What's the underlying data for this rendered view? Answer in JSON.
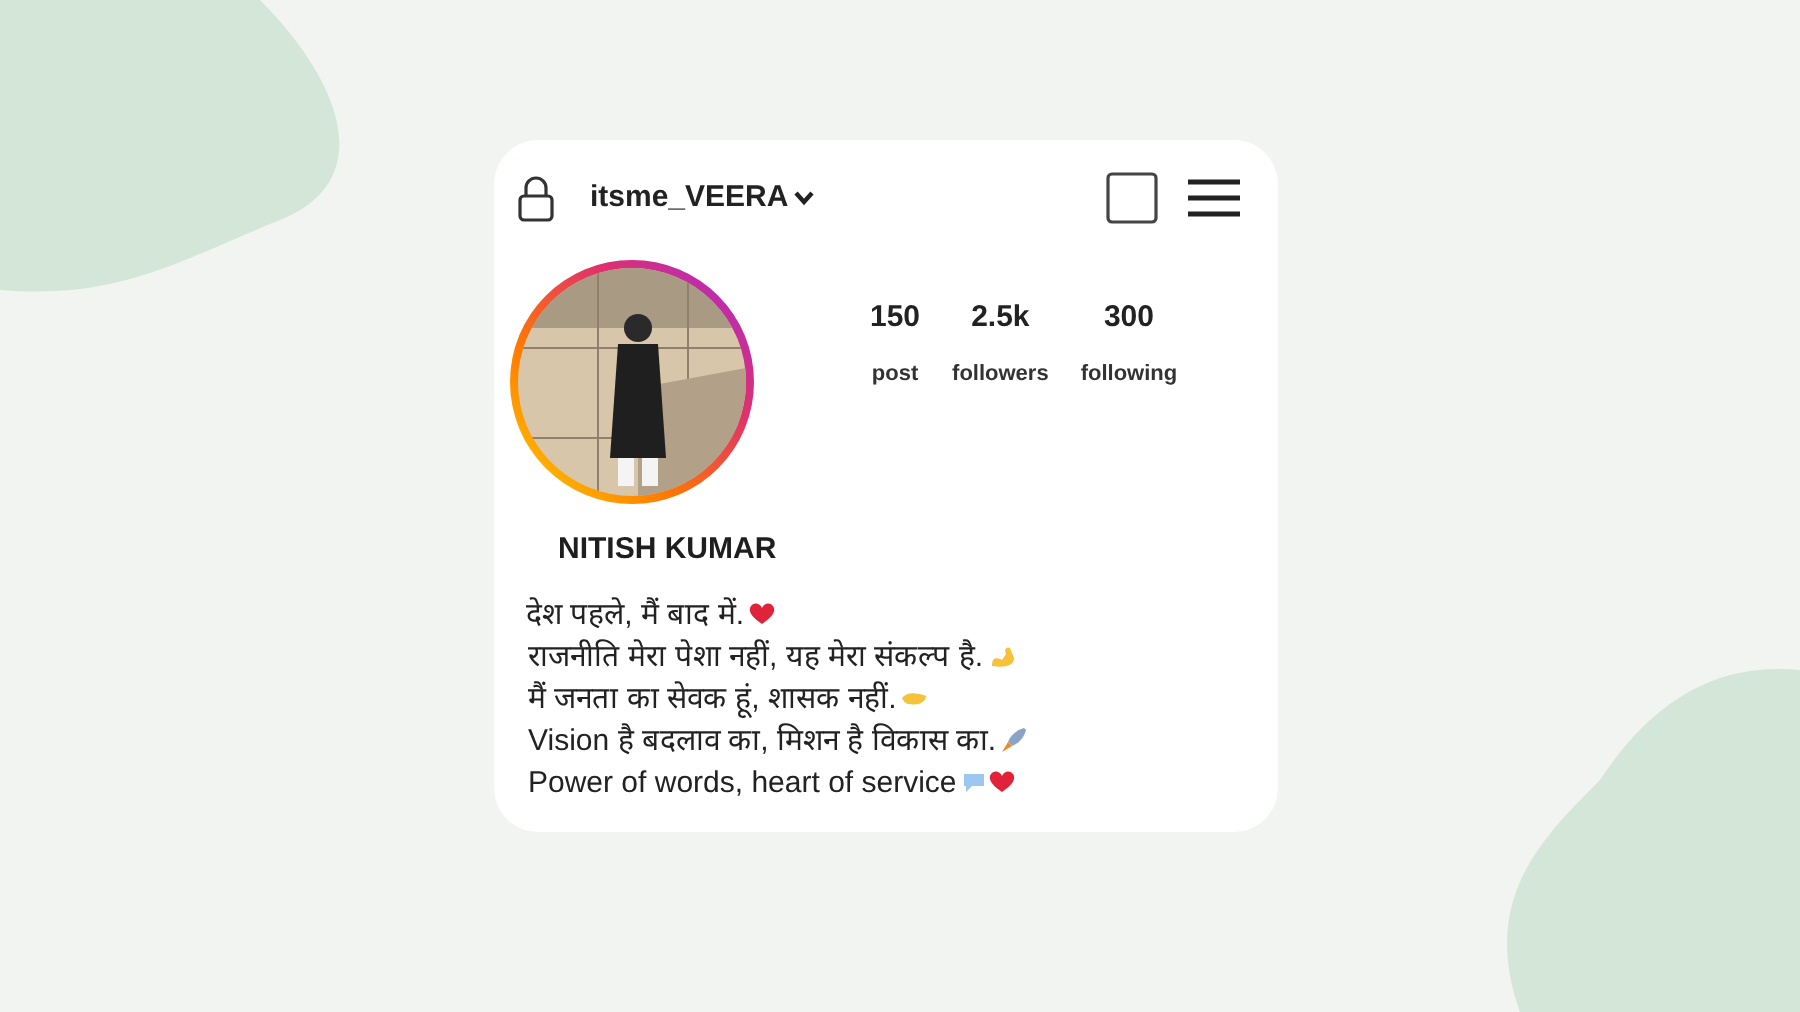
{
  "profile": {
    "username": "itsme_VEERA",
    "stats": [
      {
        "value": "150",
        "label": "post"
      },
      {
        "value": "2.5k",
        "label": "followers"
      },
      {
        "value": "300",
        "label": "following"
      }
    ],
    "name": "NITISH KUMAR",
    "bio": [
      "देश पहले, मैं बाद में.",
      "राजनीति मेरा पेशा नहीं, यह मेरा संकल्प है.",
      "मैं जनता का सेवक हूं, शासक नहीं.",
      "Vision है बदलाव का, मिशन है विकास का.",
      "Power of words, heart of service"
    ]
  }
}
